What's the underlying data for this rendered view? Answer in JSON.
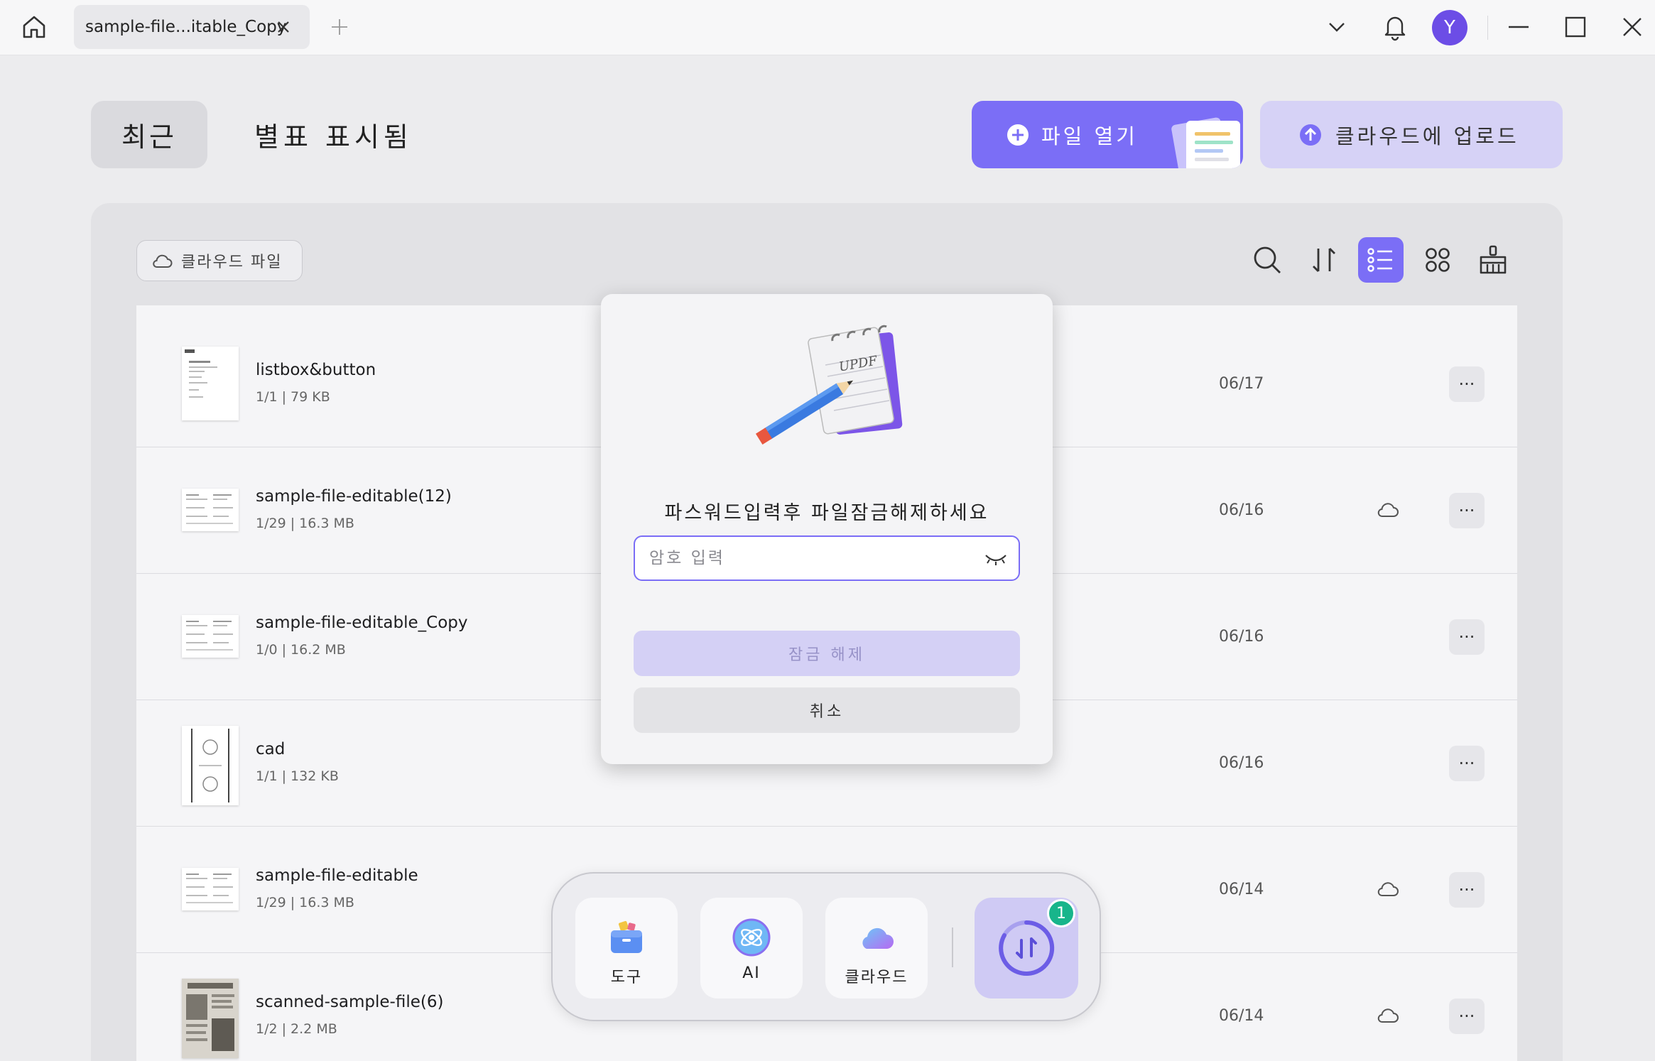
{
  "titlebar": {
    "tab_label": "sample-file...itable_Copy",
    "avatar_letter": "Y"
  },
  "header": {
    "recent_label": "최근",
    "starred_label": "별표 표시됨",
    "open_file_label": "파일 열기",
    "upload_cloud_label": "클라우드에 업로드"
  },
  "toolbar": {
    "cloud_files_label": "클라우드 파일"
  },
  "files": [
    {
      "name": "listbox&button",
      "meta": "1/1 | 79 KB",
      "date": "06/17",
      "cloud": false
    },
    {
      "name": "sample-file-editable(12)",
      "meta": "1/29 | 16.3 MB",
      "date": "06/16",
      "cloud": true
    },
    {
      "name": "sample-file-editable_Copy",
      "meta": "1/0 | 16.2 MB",
      "date": "06/16",
      "cloud": false
    },
    {
      "name": "cad",
      "meta": "1/1 | 132 KB",
      "date": "06/16",
      "cloud": false
    },
    {
      "name": "sample-file-editable",
      "meta": "1/29 | 16.3 MB",
      "date": "06/14",
      "cloud": true
    },
    {
      "name": "scanned-sample-file(6)",
      "meta": "1/2 | 2.2 MB",
      "date": "06/14",
      "cloud": true
    }
  ],
  "modal": {
    "title": "파스워드입력후 파일잠금해제하세요",
    "password_placeholder": "암호 입력",
    "password_value": "",
    "unlock_label": "잠금 해제",
    "cancel_label": "취소",
    "illustration_text": "UPDF"
  },
  "dock": {
    "tools_label": "도구",
    "ai_label": "AI",
    "cloud_label": "클라우드",
    "badge_count": "1"
  },
  "colors": {
    "accent": "#7b6ef6",
    "accent_light": "#d6d2f6",
    "badge": "#18b58b"
  }
}
